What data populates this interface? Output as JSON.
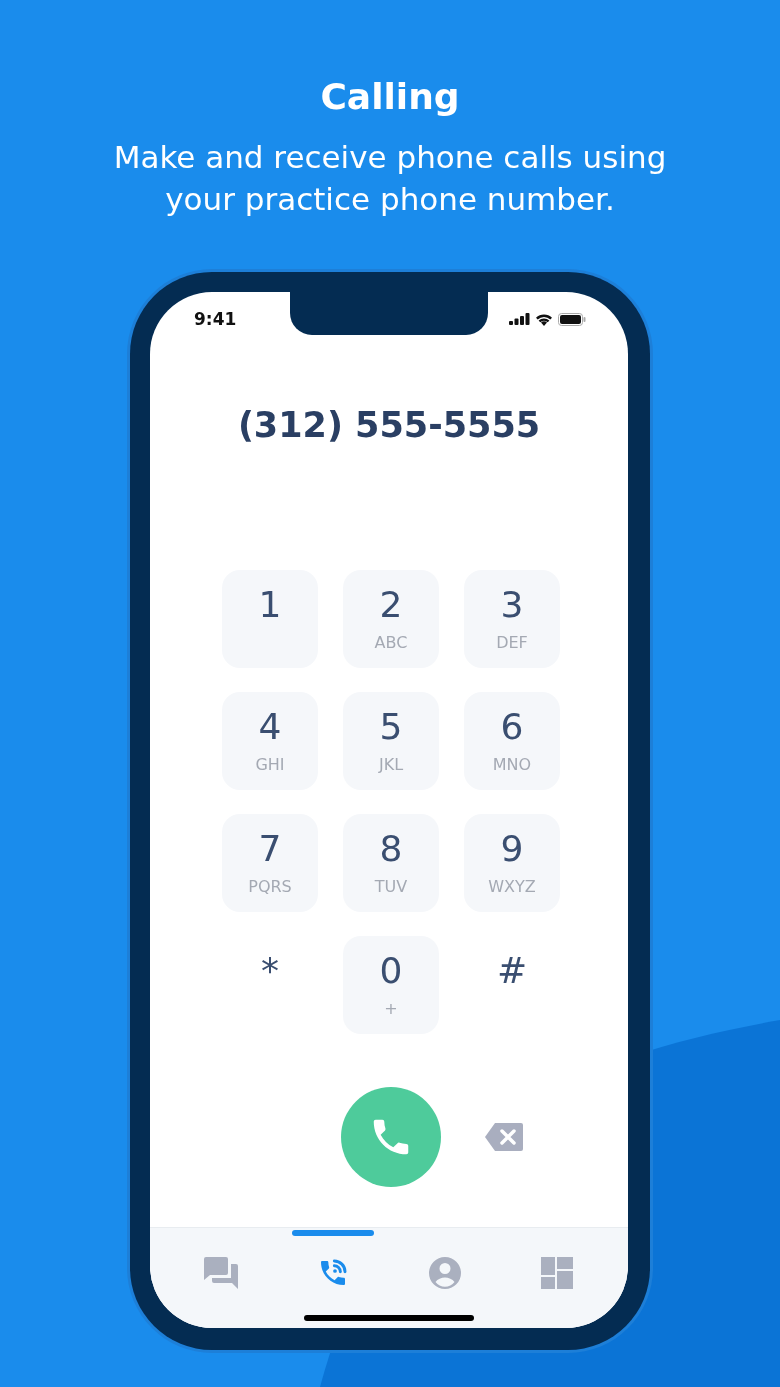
{
  "header": {
    "title": "Calling",
    "subtitle": "Make and receive phone calls using your practice phone number."
  },
  "status_bar": {
    "time": "9:41"
  },
  "dialer": {
    "number": "(312) 555-5555",
    "keys": [
      {
        "kind": "tile",
        "digit": "1"
      },
      {
        "kind": "tile",
        "digit": "2",
        "letters": "ABC"
      },
      {
        "kind": "tile",
        "digit": "3",
        "letters": "DEF"
      },
      {
        "kind": "tile",
        "digit": "4",
        "letters": "GHI"
      },
      {
        "kind": "tile",
        "digit": "5",
        "letters": "JKL"
      },
      {
        "kind": "tile",
        "digit": "6",
        "letters": "MNO"
      },
      {
        "kind": "tile",
        "digit": "7",
        "letters": "PQRS"
      },
      {
        "kind": "tile",
        "digit": "8",
        "letters": "TUV"
      },
      {
        "kind": "tile",
        "digit": "9",
        "letters": "WXYZ"
      },
      {
        "kind": "plain",
        "digit": "*"
      },
      {
        "kind": "tile",
        "digit": "0",
        "letters": "+"
      },
      {
        "kind": "plain",
        "digit": "#"
      }
    ]
  },
  "tab_bar": [
    {
      "kind": "messages",
      "selected": false
    },
    {
      "kind": "calls",
      "selected": true
    },
    {
      "kind": "contacts",
      "selected": false
    },
    {
      "kind": "apps",
      "selected": false
    }
  ]
}
